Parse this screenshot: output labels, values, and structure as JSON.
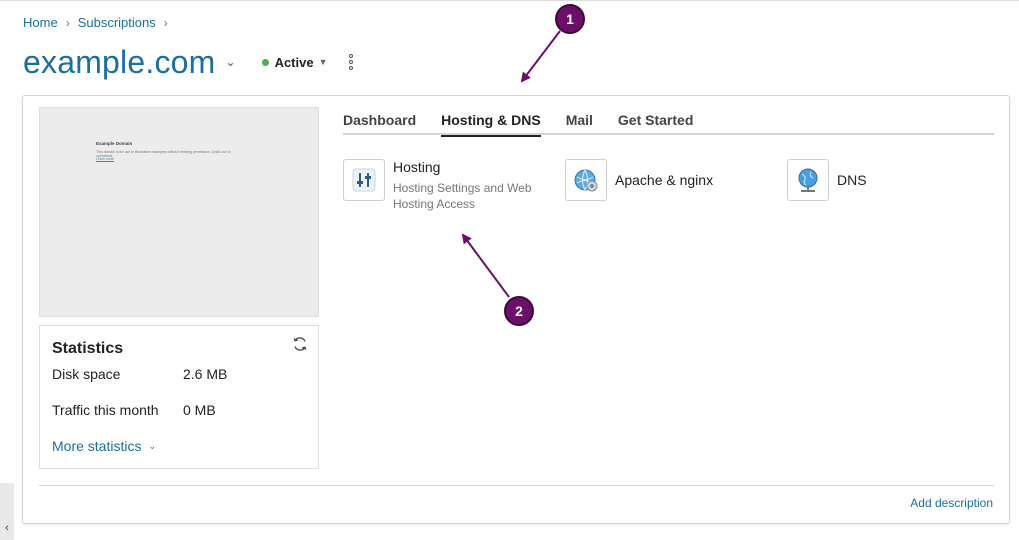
{
  "breadcrumb": {
    "items": [
      "Home",
      "Subscriptions"
    ]
  },
  "header": {
    "title": "example.com",
    "status": "Active",
    "status_color": "#4caf50"
  },
  "preview": {
    "title": "Example Domain",
    "text": "This domain is for use in illustrative examples without needing permission. Avoid use in operations.",
    "link": "Learn more"
  },
  "stats": {
    "title": "Statistics",
    "disk_label": "Disk space",
    "disk_value": "2.6 MB",
    "traffic_label": "Traffic this month",
    "traffic_value": "0 MB",
    "more_label": "More statistics"
  },
  "tabs": [
    {
      "label": "Dashboard",
      "active": false
    },
    {
      "label": "Hosting & DNS",
      "active": true
    },
    {
      "label": "Mail",
      "active": false
    },
    {
      "label": "Get Started",
      "active": false
    }
  ],
  "tools": [
    {
      "name": "Hosting",
      "desc": "Hosting Settings and Web Hosting Access",
      "icon": "hosting-sliders-icon"
    },
    {
      "name": "Apache & nginx",
      "desc": "",
      "icon": "apache-globe-gear-icon"
    },
    {
      "name": "DNS",
      "desc": "",
      "icon": "dns-globe-icon"
    }
  ],
  "footer": {
    "add_description": "Add description"
  },
  "callouts": [
    {
      "label": "1"
    },
    {
      "label": "2"
    }
  ],
  "colors": {
    "accent": "#1a6fa0",
    "callout": "#6b0f6b"
  }
}
